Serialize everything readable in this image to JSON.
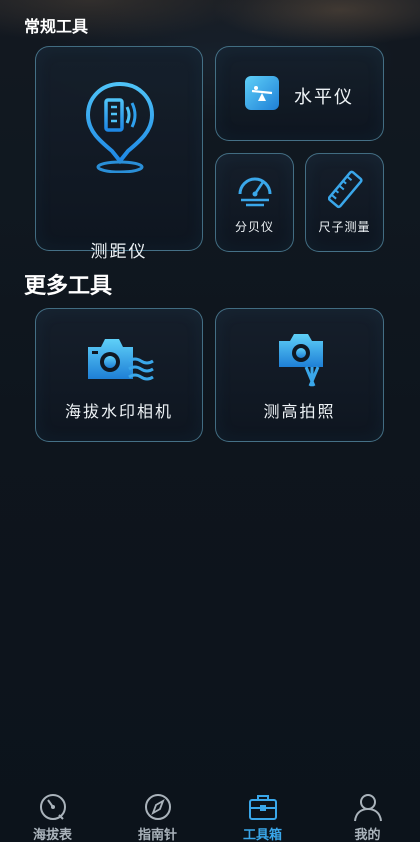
{
  "sections": {
    "common_title": "常规工具",
    "more_title": "更多工具"
  },
  "tools": {
    "rangefinder": "测距仪",
    "level": "水平仪",
    "decibel": "分贝仪",
    "ruler": "尺子测量",
    "altitude_camera": "海拔水印相机",
    "height_photo": "测高拍照"
  },
  "tabbar": {
    "items": [
      {
        "label": "海拔表",
        "icon": "altimeter-icon",
        "active": false
      },
      {
        "label": "指南针",
        "icon": "compass-icon",
        "active": false
      },
      {
        "label": "工具箱",
        "icon": "toolbox-icon",
        "active": true
      },
      {
        "label": "我的",
        "icon": "profile-icon",
        "active": false
      }
    ]
  },
  "colors": {
    "accent": "#3aa7ea",
    "card_border": "#6eb4d2",
    "background": "#0e151d"
  }
}
